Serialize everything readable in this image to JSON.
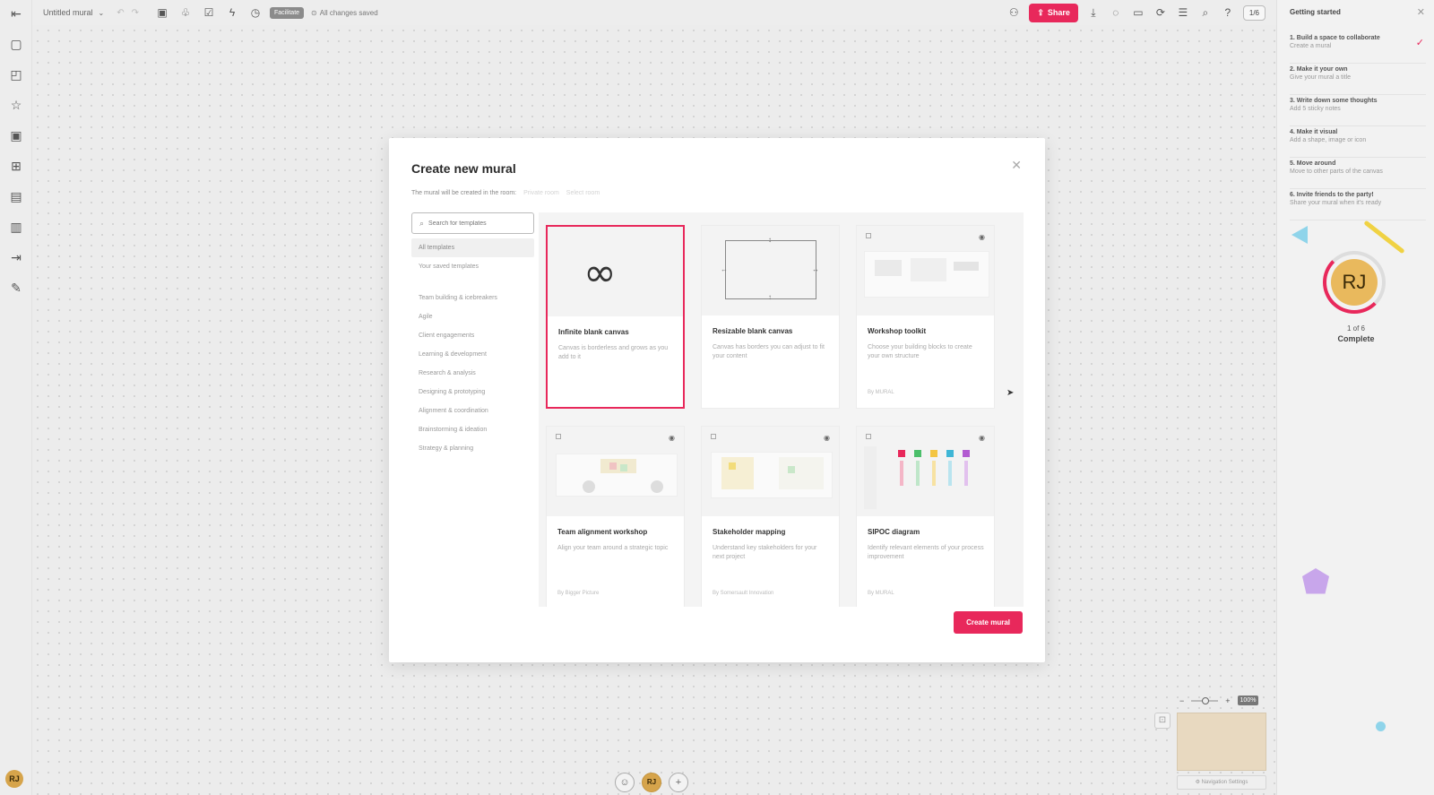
{
  "topbar": {
    "mural_title": "Untitled mural",
    "facilitate_label": "Facilitate",
    "saved_text": "All changes saved",
    "share_label": "Share",
    "collab_count": "1/6"
  },
  "right_panel": {
    "title": "Getting started",
    "steps": [
      {
        "title": "1. Build a space to collaborate",
        "sub": "Create a mural",
        "done": true
      },
      {
        "title": "2. Make it your own",
        "sub": "Give your mural a title",
        "done": false
      },
      {
        "title": "3. Write down some thoughts",
        "sub": "Add 5 sticky notes",
        "done": false
      },
      {
        "title": "4. Make it visual",
        "sub": "Add a shape, image or icon",
        "done": false
      },
      {
        "title": "5. Move around",
        "sub": "Move to other parts of the canvas",
        "done": false
      },
      {
        "title": "6. Invite friends to the party!",
        "sub": "Share your mural when it's ready",
        "done": false
      }
    ],
    "avatar_initials": "RJ",
    "progress": "1 of 6",
    "progress_status": "Complete"
  },
  "zoom": {
    "percent": "100%"
  },
  "minimap": {
    "nav_settings": "Navigation Settings"
  },
  "user": {
    "initials": "RJ"
  },
  "modal": {
    "title": "Create new mural",
    "room_text": "The mural will be created in the room:",
    "room_name": "Private room",
    "workspace_name": "Select room",
    "search_placeholder": "Search for templates",
    "categories_top": [
      "All templates",
      "Your saved templates"
    ],
    "categories": [
      "Team building & icebreakers",
      "Agile",
      "Client engagements",
      "Learning & development",
      "Research & analysis",
      "Designing & prototyping",
      "Alignment & coordination",
      "Brainstorming & ideation",
      "Strategy & planning"
    ],
    "templates": [
      {
        "title": "Infinite blank canvas",
        "desc": "Canvas is borderless and grows as you add to it",
        "by": ""
      },
      {
        "title": "Resizable blank canvas",
        "desc": "Canvas has borders you can adjust to fit your content",
        "by": ""
      },
      {
        "title": "Workshop toolkit",
        "desc": "Choose your building blocks to create your own structure",
        "by": "By MURAL"
      },
      {
        "title": "Team alignment workshop",
        "desc": "Align your team around a strategic topic",
        "by": "By Bigger Picture"
      },
      {
        "title": "Stakeholder mapping",
        "desc": "Understand key stakeholders for your next project",
        "by": "By Somersault Innovation"
      },
      {
        "title": "SIPOC diagram",
        "desc": "Identify relevant elements of your process improvement",
        "by": "By MURAL"
      }
    ],
    "create_label": "Create mural"
  },
  "colors": {
    "accent": "#e8285b",
    "avatar": "#e9b95d"
  }
}
